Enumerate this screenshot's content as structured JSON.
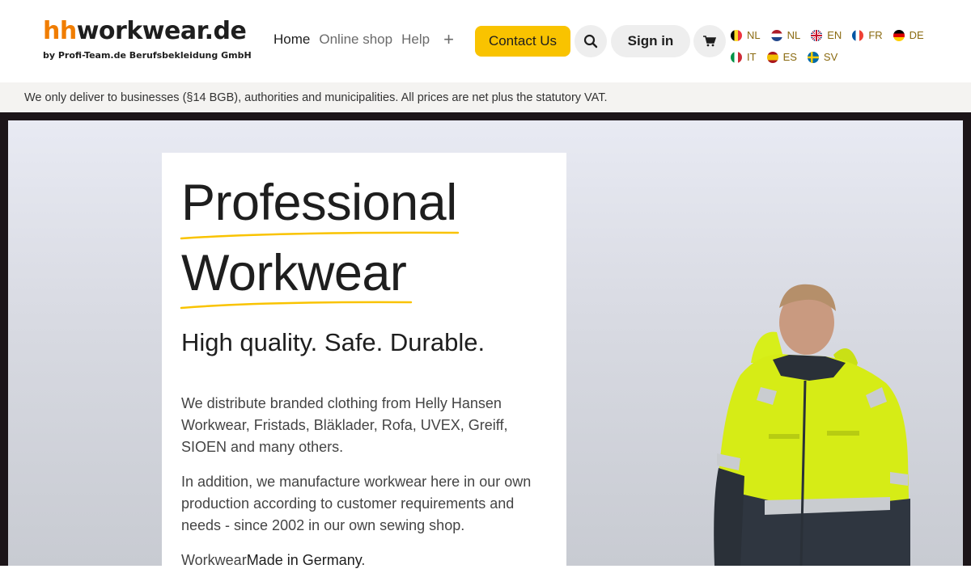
{
  "brand": {
    "logo_prefix": "hh",
    "logo_main": "workwear.de",
    "logo_sub": "by Profi-Team.de Berufsbekleidung GmbH",
    "accent_color": "#f07d00"
  },
  "nav": {
    "items": [
      "Home",
      "Online shop",
      "Help"
    ],
    "more": "+"
  },
  "header": {
    "contact_label": "Contact Us",
    "signin_label": "Sign in",
    "search_icon": "search-icon",
    "cart_icon": "cart-icon",
    "contact_color": "#f9c300"
  },
  "languages": [
    {
      "code": "NL",
      "flag": "belgium"
    },
    {
      "code": "NL",
      "flag": "netherlands"
    },
    {
      "code": "EN",
      "flag": "uk"
    },
    {
      "code": "FR",
      "flag": "france"
    },
    {
      "code": "DE",
      "flag": "germany"
    },
    {
      "code": "IT",
      "flag": "italy"
    },
    {
      "code": "ES",
      "flag": "spain"
    },
    {
      "code": "SV",
      "flag": "sweden"
    }
  ],
  "notice": "We only deliver to businesses (§14 BGB), authorities and municipalities. All prices are net plus the statutory VAT.",
  "hero": {
    "title_line1": "Professional",
    "title_line2": "Workwear",
    "tagline": "High quality. Safe. Durable.",
    "paragraph1": "We distribute branded clothing from Helly Hansen Workwear, Fristads, Bläklader, Rofa, UVEX, Greiff, SIOEN and many others.",
    "paragraph2": "In addition, we manufacture workwear here in our own production according to customer requirements and needs - since 2002 in our own sewing shop.",
    "paragraph3_prefix": "Workwear",
    "paragraph3_emphasis": "Made in Germany",
    "paragraph3_suffix": ".",
    "underline_color": "#f9c300"
  }
}
